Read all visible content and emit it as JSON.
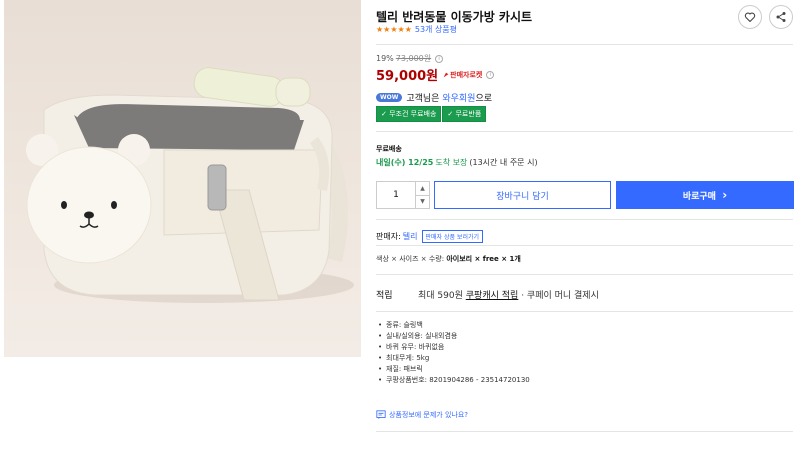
{
  "product": {
    "title": "텔리 반려동물 이동가방 카시트",
    "stars": "★★★★★",
    "review_count": "53개 상품평",
    "rating_value": 5
  },
  "price": {
    "discount_rate": "19%",
    "original": "73,000원",
    "sale": "59,000원",
    "seller_rocket": "판매자로켓"
  },
  "membership": {
    "badge": "WOW",
    "text_before": "고객님은",
    "link": "와우회원",
    "text_after": "으로",
    "chips": [
      "✓ 무조건 무료배송",
      "✓ 무료반품"
    ]
  },
  "shipping": {
    "label": "무료배송",
    "date": "내일(수) 12/25",
    "guarantee": "도착 보장",
    "note": "(13시간 내 주문 시)"
  },
  "purchase": {
    "quantity": "1",
    "cart_label": "장바구니 담기",
    "buy_label": "바로구매",
    "buy_arrow": "›"
  },
  "seller": {
    "label": "판매자:",
    "name": "텔리",
    "more_label": "판매자 상품 보러가기"
  },
  "options": {
    "prefix": "색상 × 사이즈 × 수량:",
    "selection": "아이보리 × free × 1개"
  },
  "benefit": {
    "label": "적립",
    "text": "최대 590원",
    "link": "쿠팡캐시 적립",
    "suffix": "· 쿠페이 머니 결제시"
  },
  "specs": [
    "종류: 슬링백",
    "실내/실외용: 실내외겸용",
    "바퀴 유무: 바퀴없음",
    "최대무게: 5kg",
    "재질: 패브릭",
    "쿠팡상품번호: 8201904286 - 23514720130"
  ],
  "report_link": "상품정보에 문제가 있나요?",
  "colors": {
    "accent": "#346aff",
    "price": "#ae0000",
    "green": "#1b9b4e",
    "star": "#f27d0c"
  },
  "icons": [
    "heart-icon",
    "share-icon",
    "info-icon",
    "rocket-icon",
    "chevron-right-icon",
    "report-icon"
  ]
}
